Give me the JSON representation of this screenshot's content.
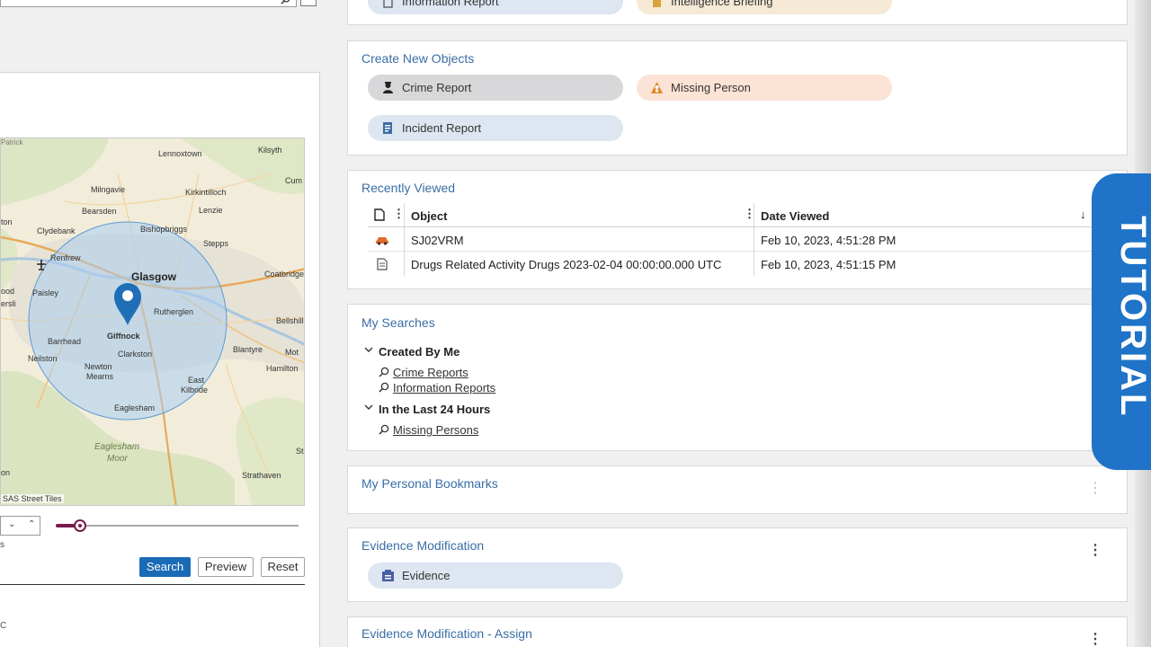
{
  "top_search": {
    "search_icon": "search-icon",
    "advanced_icon": "advanced-search-icon"
  },
  "top_card": {
    "pills": [
      "Information Report",
      "Intelligence Briefing"
    ]
  },
  "map": {
    "labels": [
      "Kilsyth",
      "Lennoxtown",
      "Milngavie",
      "Kirkintilloch",
      "Bearsden",
      "Lenzie",
      "Clydebank",
      "Bishopbriggs",
      "Stepps",
      "Renfrew",
      "Glasgow",
      "Coatbridge",
      "Paisley",
      "Rutherglen",
      "Bellshill",
      "Giffnock",
      "Barrhead",
      "Blantyre",
      "Clarkston",
      "Neilston",
      "Newton",
      "Mearns",
      "Hamilton",
      "East",
      "Kilbride",
      "Eaglesham",
      "Eaglesham",
      "Moor",
      "Strathaven",
      "Cum",
      "Mot",
      "ood",
      "ersli",
      "ton",
      "on",
      "St",
      "Patrick"
    ],
    "credit": "SAS Street Tiles",
    "colors": {
      "radius_fill": "#a9cdf0",
      "pin": "#1f6fb8"
    }
  },
  "controls": {
    "stepper_down": "⌄",
    "stepper_up": "⌃",
    "units_fragment": "s",
    "search_button": "Search",
    "preview_button": "Preview",
    "reset_button": "Reset",
    "footer_fragment": "C",
    "slider_value_fraction": 0.1
  },
  "create_objects": {
    "title": "Create New Objects",
    "pills": [
      "Crime Report",
      "Missing Person",
      "Incident Report"
    ]
  },
  "recently_viewed": {
    "title": "Recently Viewed",
    "columns": [
      "Object",
      "Date Viewed"
    ],
    "rows": [
      {
        "object": "SJ02VRM",
        "date": "Feb 10, 2023, 4:51:28 PM",
        "icon": "car-icon"
      },
      {
        "object": "Drugs Related Activity Drugs 2023-02-04 00:00:00.000 UTC",
        "date": "Feb 10, 2023, 4:51:15 PM",
        "icon": "document-icon"
      }
    ]
  },
  "my_searches": {
    "title": "My Searches",
    "groups": [
      {
        "label": "Created By Me",
        "items": [
          "Crime Reports",
          "Information Reports"
        ]
      },
      {
        "label": "In the Last 24 Hours",
        "items": [
          "Missing Persons"
        ]
      }
    ]
  },
  "bookmarks": {
    "title": "My Personal Bookmarks"
  },
  "evidence_mod": {
    "title": "Evidence Modification",
    "pill": "Evidence"
  },
  "evidence_assign": {
    "title": "Evidence Modification - Assign"
  },
  "tutorial": {
    "label": "TUTORIAL",
    "color": "#1f73c8"
  },
  "glyphs": {
    "kebab": "⋮",
    "sort_desc": "↓",
    "chevron": "⌄",
    "mag": "⌕"
  }
}
